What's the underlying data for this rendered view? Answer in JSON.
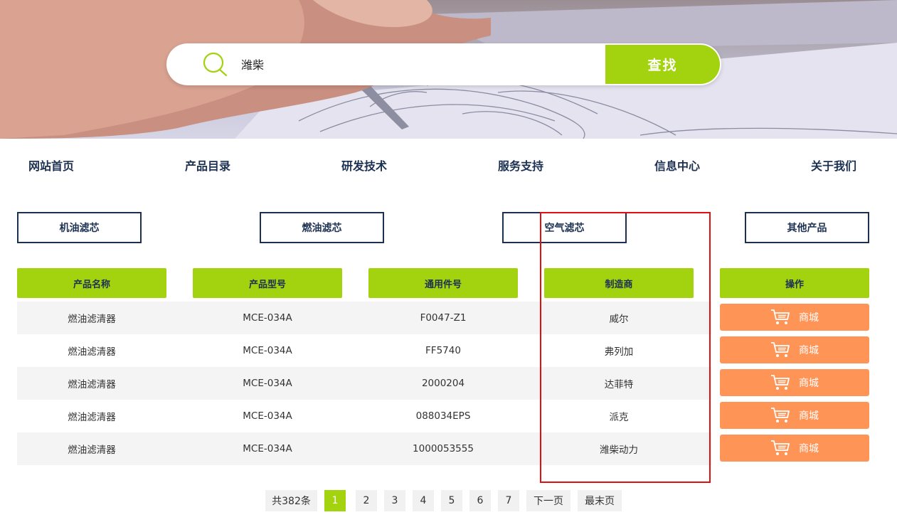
{
  "search": {
    "value": "潍柴",
    "button_label": "查找"
  },
  "nav": {
    "items": [
      "网站首页",
      "产品目录",
      "研发技术",
      "服务支持",
      "信息中心",
      "关于我们"
    ]
  },
  "categories": [
    "机油滤芯",
    "燃油滤芯",
    "空气滤芯",
    "其他产品"
  ],
  "table": {
    "headers": [
      "产品名称",
      "产品型号",
      "通用件号",
      "制造商",
      "操作"
    ],
    "rows": [
      {
        "name": "燃油滤清器",
        "model": "MCE-034A",
        "part": "F0047-Z1",
        "maker": "威尔",
        "action": "商城"
      },
      {
        "name": "燃油滤清器",
        "model": "MCE-034A",
        "part": "FF5740",
        "maker": "弗列加",
        "action": "商城"
      },
      {
        "name": "燃油滤清器",
        "model": "MCE-034A",
        "part": "2000204",
        "maker": "达菲特",
        "action": "商城"
      },
      {
        "name": "燃油滤清器",
        "model": "MCE-034A",
        "part": "088034EPS",
        "maker": "派克",
        "action": "商城"
      },
      {
        "name": "燃油滤清器",
        "model": "MCE-034A",
        "part": "1000053555",
        "maker": "潍柴动力",
        "action": "商城"
      }
    ]
  },
  "pagination": {
    "total": "共382条",
    "pages": [
      "1",
      "2",
      "3",
      "4",
      "5",
      "6",
      "7"
    ],
    "current": "1",
    "next": "下一页",
    "last": "最末页"
  },
  "colors": {
    "accent": "#a3d20e",
    "navy": "#1c3152",
    "shop": "#ff9457",
    "highlight": "#e01010"
  },
  "icons": {
    "search": "search-icon",
    "cart": "cart-icon"
  }
}
